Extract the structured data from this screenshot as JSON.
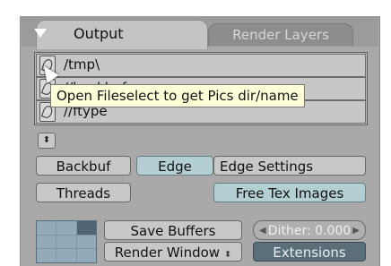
{
  "tabs": {
    "output": "Output",
    "render_layers": "Render Layers"
  },
  "paths": [
    {
      "value": "/tmp\\"
    },
    {
      "value": "//backbuf"
    },
    {
      "value": "//ftype"
    }
  ],
  "tooltip": "Open Fileselect to get Pics dir/name",
  "buttons": {
    "backbuf": "Backbuf",
    "edge": "Edge",
    "edge_settings": "Edge Settings",
    "threads": "Threads",
    "free_tex_images": "Free Tex Images",
    "save_buffers": "Save Buffers",
    "render_window": "Render Window",
    "extensions": "Extensions"
  },
  "dither": {
    "label": "Dither: 0.000"
  },
  "small_toggle_glyph": "⬍",
  "select_arrows": "⬍",
  "colors": {
    "panel_bg": "#a9a9a9",
    "tooltip_bg": "#ffffd8",
    "active_teal": "#b4cfd2",
    "dark_button": "#5a6f78"
  }
}
